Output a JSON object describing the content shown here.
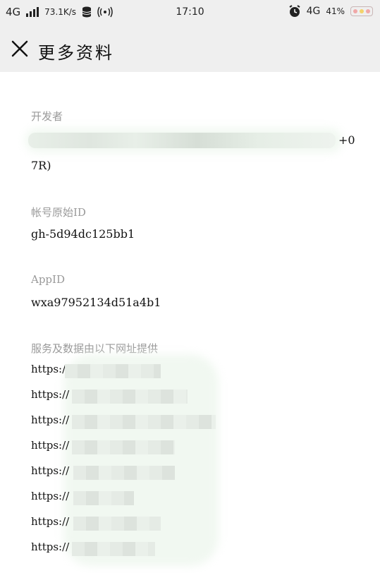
{
  "status_bar": {
    "network_left": "4G",
    "speed": "73.1K/s",
    "time": "17:10",
    "network_right": "4G",
    "battery": "41%"
  },
  "header": {
    "title": "更多资料"
  },
  "sections": {
    "developer": {
      "label": "开发者",
      "value_tail": "+0",
      "value_line2": "7R)"
    },
    "original_id": {
      "label": "帐号原始ID",
      "value": "gh-5d94dc125bb1"
    },
    "appid": {
      "label": "AppID",
      "value": "wxa97952134d51a4b1"
    },
    "services": {
      "label": "服务及数据由以下网址提供",
      "urls": [
        "https:/",
        "https://",
        "https://",
        "https://",
        "https://",
        "https://",
        "https://",
        "https://"
      ]
    }
  },
  "icons": {
    "close": "close-icon",
    "alarm": "alarm-icon",
    "signal": "signal-bars-icon",
    "database": "database-icon",
    "wifi_hotspot": "hotspot-icon",
    "battery": "battery-icon"
  }
}
